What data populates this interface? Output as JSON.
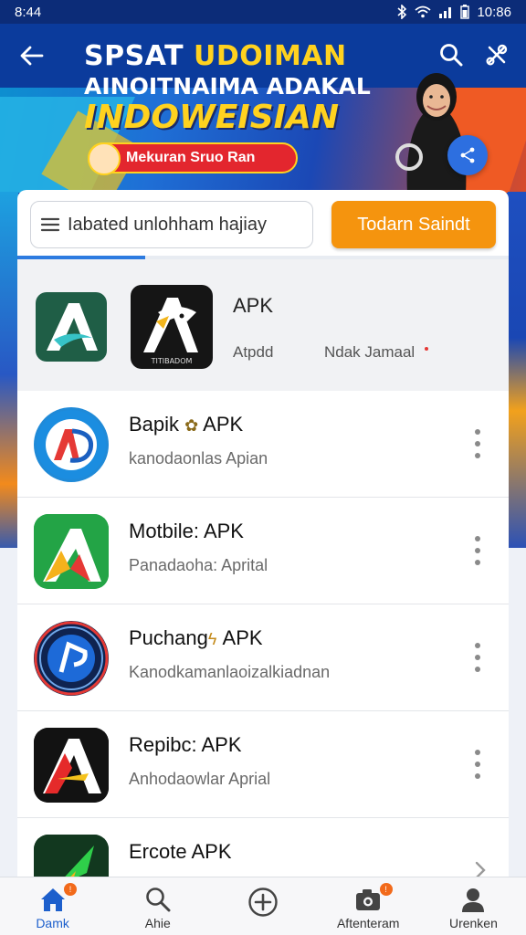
{
  "status_bar": {
    "time": "8:44",
    "battery_time": "10:86"
  },
  "banner": {
    "title_line1_white": "SPSAT",
    "title_line1_yellow": "UDOIMAN",
    "title_line2": "AINOITNAIMA ADAKAL",
    "title_line3": "INDOWEISIAN",
    "pill_text": "Mekuran Sruo Ran"
  },
  "search": {
    "placeholder": "Iabated unlohham hajiay",
    "button_label": "Todarn Saindt",
    "progress_fraction": 0.26
  },
  "featured": {
    "title": "APK",
    "sub1": "Atpdd",
    "sub2": "Ndak Jamaal",
    "icon2_caption": "TITIBADOM"
  },
  "apps": [
    {
      "name": "Bapik",
      "suffix": "APK",
      "desc": "kanodaonlas Apian"
    },
    {
      "name": "Motbile:",
      "suffix": "APK",
      "desc": "Panadaoha: Aprital"
    },
    {
      "name": "Puchang",
      "suffix": "APK",
      "desc": "Kanodkamanlaoizalkiadnan"
    },
    {
      "name": "Repibc:",
      "suffix": "APK",
      "desc": "Anhodaowlar Aprial"
    },
    {
      "name": "Ercote",
      "suffix": "APK",
      "desc": ""
    }
  ],
  "nav": [
    {
      "label": "Damk",
      "icon": "home-icon"
    },
    {
      "label": "Ahie",
      "icon": "search-icon"
    },
    {
      "label": "",
      "icon": "add-circle-icon"
    },
    {
      "label": "Aftenteram",
      "icon": "camera-icon"
    },
    {
      "label": "Urenken",
      "icon": "person-icon"
    }
  ],
  "colors": {
    "accent": "#f5940e",
    "primary": "#1d5fcc",
    "header": "#0b3b9c"
  }
}
